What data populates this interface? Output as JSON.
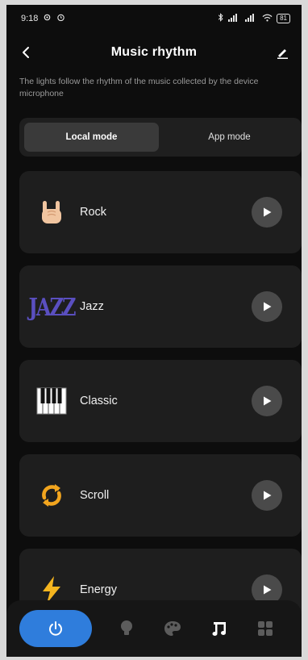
{
  "status_bar": {
    "time": "9:18",
    "left_icons": [
      "settings-gear-icon",
      "alarm-icon"
    ],
    "battery": "81"
  },
  "header": {
    "title": "Music rhythm"
  },
  "subtitle": "The lights follow the rhythm of the music collected by the device microphone",
  "mode_switch": {
    "tabs": [
      {
        "label": "Local mode",
        "active": true
      },
      {
        "label": "App mode",
        "active": false
      }
    ]
  },
  "rhythms": [
    {
      "label": "Rock",
      "icon": "rock-hand-icon"
    },
    {
      "label": "Jazz",
      "icon": "jazz-logo-icon",
      "icon_text": "JAZZ"
    },
    {
      "label": "Classic",
      "icon": "piano-keys-icon"
    },
    {
      "label": "Scroll",
      "icon": "scroll-arrows-icon"
    },
    {
      "label": "Energy",
      "icon": "lightning-icon"
    }
  ],
  "bottom_nav": {
    "items": [
      "power-icon",
      "bulb-icon",
      "palette-icon",
      "music-icon",
      "grid-icon"
    ],
    "active": "music-icon"
  },
  "colors": {
    "background": "#0d0d0d",
    "card": "#1e1e1e",
    "accent_blue": "#2f7ddc",
    "jazz_purple": "#5a4fc0",
    "scroll_orange": "#f2a51e",
    "energy_yellow": "#f5b51f"
  }
}
